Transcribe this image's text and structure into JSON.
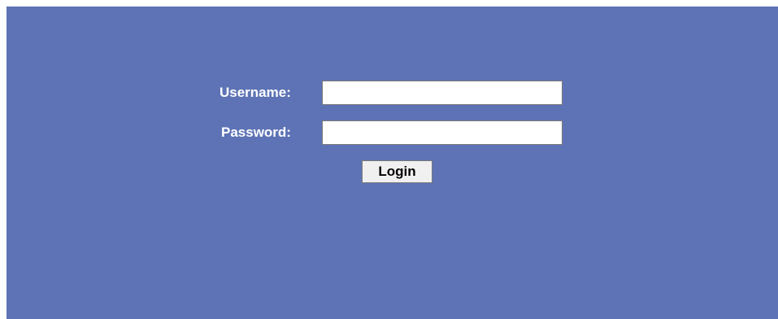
{
  "login_form": {
    "username_label": "Username:",
    "username_value": "",
    "password_label": "Password:",
    "password_value": "",
    "submit_label": "Login"
  },
  "colors": {
    "panel_background": "#5e73b5",
    "label_text": "#ffffff",
    "input_background": "#ffffff",
    "button_background": "#f0f0f0"
  }
}
